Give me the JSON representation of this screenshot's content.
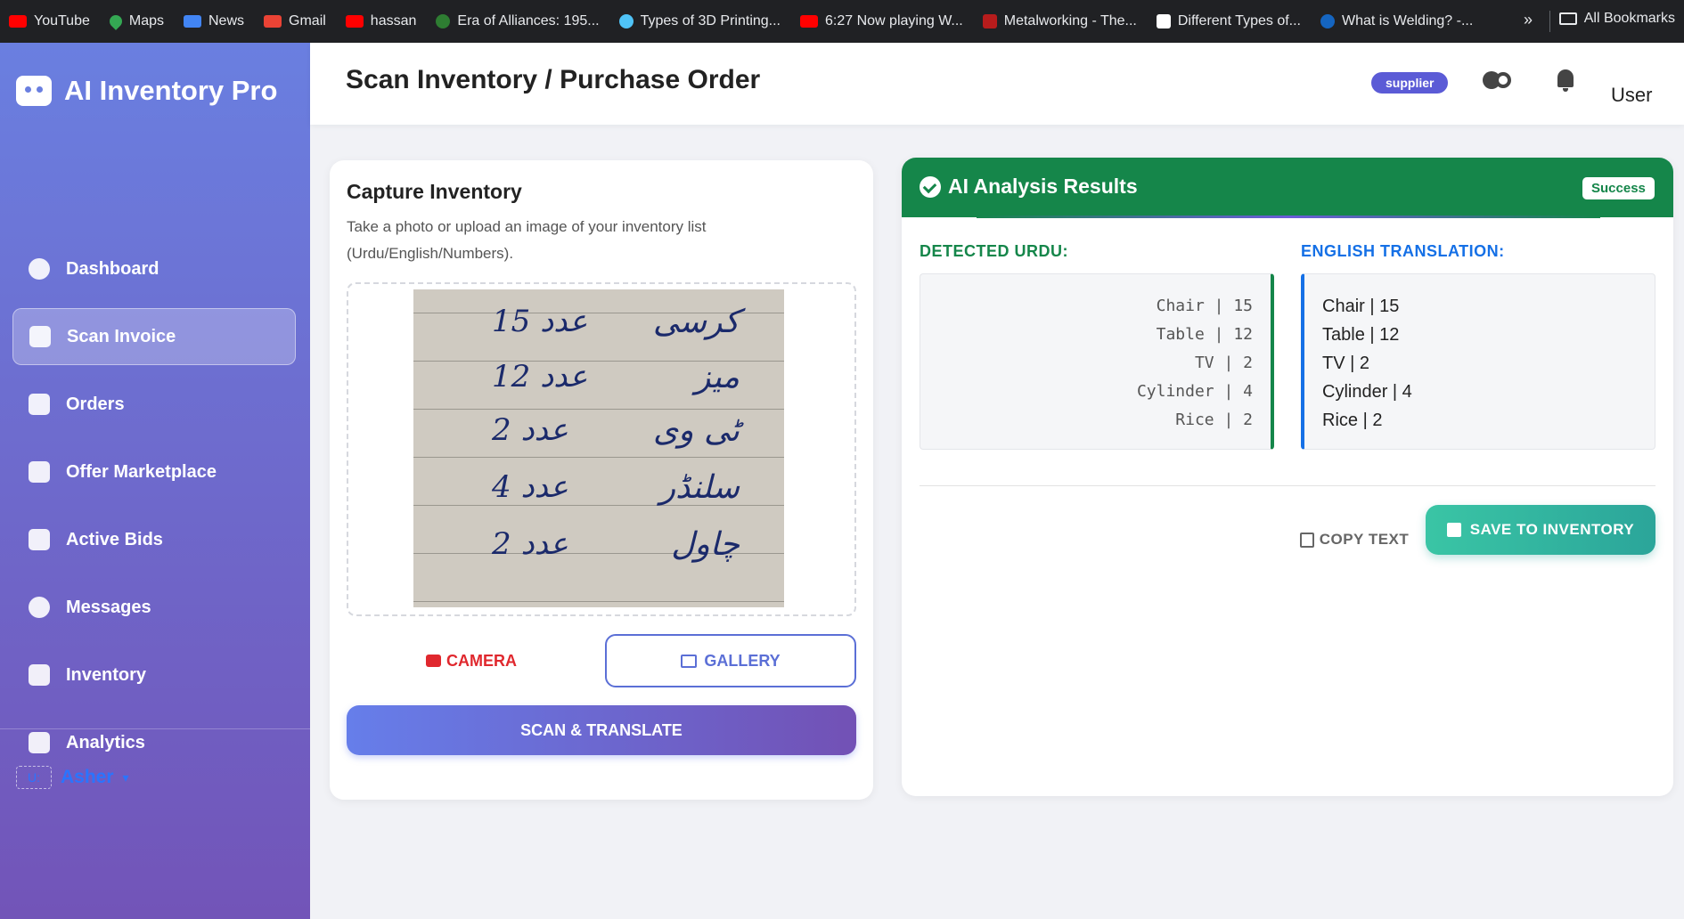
{
  "bookmarks": {
    "items": [
      {
        "label": "YouTube",
        "icon": "youtube-icon"
      },
      {
        "label": "Maps",
        "icon": "maps-icon"
      },
      {
        "label": "News",
        "icon": "news-icon"
      },
      {
        "label": "Gmail",
        "icon": "gmail-icon"
      },
      {
        "label": "hassan",
        "icon": "youtube-icon"
      },
      {
        "label": "Era of Alliances: 195...",
        "icon": "globe-icon"
      },
      {
        "label": "Types of 3D Printing...",
        "icon": "globe-icon"
      },
      {
        "label": "6:27 Now playing W...",
        "icon": "youtube-icon"
      },
      {
        "label": "Metalworking - The...",
        "icon": "tm-icon"
      },
      {
        "label": "Different Types of...",
        "icon": "doc-icon"
      },
      {
        "label": "What is Welding? -...",
        "icon": "globe-icon"
      }
    ],
    "more": "»",
    "all_bookmarks": "All Bookmarks"
  },
  "sidebar": {
    "brand": "AI Inventory Pro",
    "items": [
      {
        "label": "Dashboard",
        "icon": "dashboard-icon",
        "active": false
      },
      {
        "label": "Scan Invoice",
        "icon": "invoice-icon",
        "active": true
      },
      {
        "label": "Orders",
        "icon": "truck-icon",
        "active": false
      },
      {
        "label": "Offer Marketplace",
        "icon": "clipboard-icon",
        "active": false
      },
      {
        "label": "Active Bids",
        "icon": "gavel-icon",
        "active": false
      },
      {
        "label": "Messages",
        "icon": "chat-icon",
        "active": false
      },
      {
        "label": "Inventory",
        "icon": "boxes-icon",
        "active": false
      },
      {
        "label": "Analytics",
        "icon": "chart-line-icon",
        "active": false
      }
    ],
    "user": {
      "avatar_alt": "U:",
      "name": "Asher",
      "caret": "▾"
    }
  },
  "header": {
    "title": "Scan Inventory / Purchase Order",
    "role_badge": "supplier",
    "user_avatar_alt": "User"
  },
  "capture": {
    "title": "Capture Inventory",
    "description": "Take a photo or upload an image of your inventory list (Urdu/English/Numbers).",
    "camera_label": "CAMERA",
    "gallery_label": "GALLERY",
    "scan_label": "SCAN & TRANSLATE",
    "handwritten": [
      {
        "urdu": "کرسی",
        "number": "15 عدد"
      },
      {
        "urdu": "میز",
        "number": "12 عدد"
      },
      {
        "urdu": "ٹی وی",
        "number": "2 عدد"
      },
      {
        "urdu": "سلنڈر",
        "number": "4 عدد"
      },
      {
        "urdu": "چاول",
        "number": "2 عدد"
      }
    ]
  },
  "results": {
    "title": "AI Analysis Results",
    "status": "Success",
    "detected_label": "DETECTED URDU:",
    "translation_label": "ENGLISH TRANSLATION:",
    "detected": [
      "Chair | 15",
      "Table | 12",
      "TV | 2",
      "Cylinder | 4",
      "Rice | 2"
    ],
    "translation": [
      "Chair | 15",
      "Table | 12",
      "TV | 2",
      "Cylinder | 4",
      "Rice | 2"
    ],
    "copy_label": "COPY TEXT",
    "save_label": "SAVE TO INVENTORY"
  },
  "colors": {
    "sidebar_top": "#6a7fe0",
    "sidebar_bottom": "#7254b8",
    "success_green": "#15864a",
    "translation_blue": "#1570e6",
    "camera_red": "#e0282e",
    "save_teal": "#2ba59a"
  }
}
